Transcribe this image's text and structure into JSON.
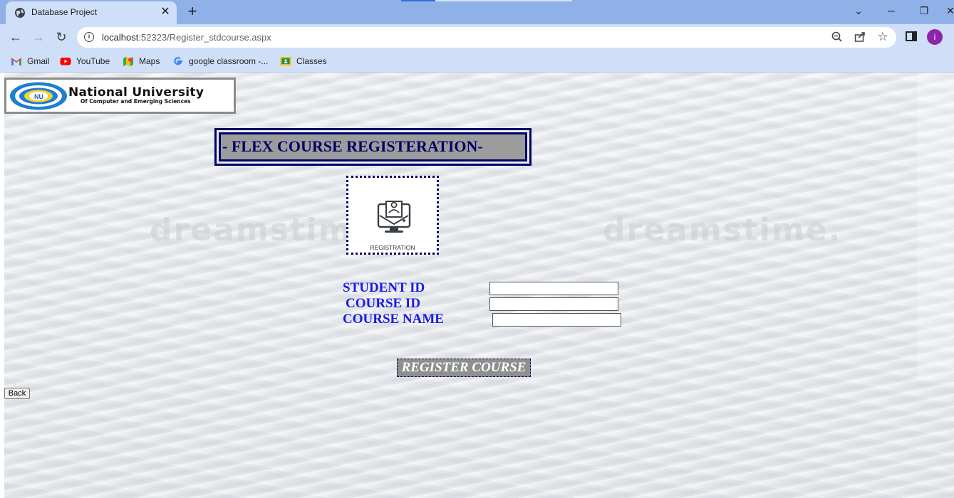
{
  "browser": {
    "tab_title": "Database Project",
    "url_host": "localhost",
    "url_rest": ":52323/Register_stdcourse.aspx",
    "bookmarks": [
      {
        "label": "Gmail",
        "icon": "gmail-icon"
      },
      {
        "label": "YouTube",
        "icon": "youtube-icon"
      },
      {
        "label": "Maps",
        "icon": "maps-icon"
      },
      {
        "label": "google classroom -...",
        "icon": "google-icon"
      },
      {
        "label": "Classes",
        "icon": "classroom-icon"
      }
    ],
    "profile_initial": "i"
  },
  "page": {
    "logo": {
      "title": "National University",
      "subtitle": "Of Computer and Emerging Sciences"
    },
    "watermark": "dreamstime.",
    "heading": "- FLEX COURSE REGISTERATION-",
    "image_label": "REGISTRATION",
    "form": {
      "student_id_label": "STUDENT ID",
      "course_id_label": "COURSE ID",
      "course_name_label": "COURSE NAME",
      "student_id_value": "",
      "course_id_value": "",
      "course_name_value": ""
    },
    "register_button": "REGISTER COURSE",
    "back_button": "Back"
  },
  "colors": {
    "heading_text": "#000066",
    "label_text": "#1a1ae6",
    "heading_bg": "#9c9c9c",
    "button_bg": "#8f8f8f",
    "avatar": "#8e24aa"
  }
}
